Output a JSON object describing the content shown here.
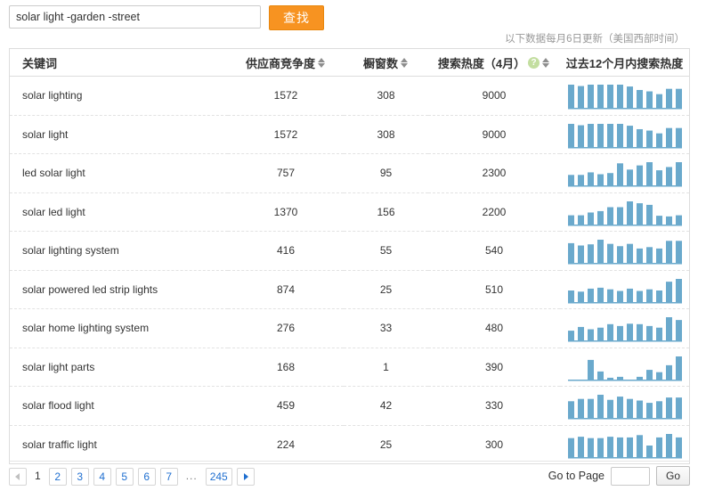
{
  "search": {
    "value": "solar light -garden -street",
    "placeholder": "",
    "button_label": "查找"
  },
  "update_note": "以下数据每月6日更新（美国西部时间）",
  "table": {
    "columns": {
      "keyword": "关键词",
      "competition": "供应商竞争度",
      "showcase": "橱窗数",
      "search_heat": "搜索热度（4月）",
      "trend": "过去12个月内搜索热度",
      "help_glyph": "?"
    },
    "rows": [
      {
        "keyword": "solar lighting",
        "competition": "1572",
        "showcase": "308",
        "search_heat": "9000",
        "trend": [
          100,
          94,
          100,
          100,
          100,
          100,
          92,
          77,
          71,
          59,
          82,
          82
        ]
      },
      {
        "keyword": "solar light",
        "competition": "1572",
        "showcase": "308",
        "search_heat": "9000",
        "trend": [
          100,
          94,
          100,
          100,
          100,
          100,
          92,
          77,
          71,
          59,
          82,
          82
        ]
      },
      {
        "keyword": "led solar light",
        "competition": "757",
        "showcase": "95",
        "search_heat": "2300",
        "trend": [
          45,
          45,
          56,
          48,
          53,
          95,
          68,
          86,
          100,
          65,
          79,
          100
        ]
      },
      {
        "keyword": "solar led light",
        "competition": "1370",
        "showcase": "156",
        "search_heat": "2200",
        "trend": [
          40,
          40,
          52,
          58,
          75,
          75,
          100,
          92,
          85,
          38,
          35,
          40
        ]
      },
      {
        "keyword": "solar lighting system",
        "competition": "416",
        "showcase": "55",
        "search_heat": "540",
        "trend": [
          85,
          75,
          80,
          100,
          82,
          72,
          82,
          62,
          68,
          62,
          95,
          95
        ]
      },
      {
        "keyword": "solar powered led strip lights",
        "competition": "874",
        "showcase": "25",
        "search_heat": "510",
        "trend": [
          50,
          45,
          58,
          62,
          55,
          48,
          58,
          48,
          55,
          50,
          88,
          100
        ]
      },
      {
        "keyword": "solar home lighting system",
        "competition": "276",
        "showcase": "33",
        "search_heat": "480",
        "trend": [
          42,
          58,
          48,
          55,
          70,
          62,
          72,
          70,
          62,
          55,
          100,
          88
        ]
      },
      {
        "keyword": "solar light parts",
        "competition": "168",
        "showcase": "1",
        "search_heat": "390",
        "trend": [
          0,
          0,
          85,
          35,
          8,
          12,
          0,
          12,
          42,
          32,
          62,
          100
        ]
      },
      {
        "keyword": "solar flood light",
        "competition": "459",
        "showcase": "42",
        "search_heat": "330",
        "trend": [
          72,
          82,
          82,
          100,
          78,
          92,
          82,
          75,
          65,
          72,
          88,
          88
        ]
      },
      {
        "keyword": "solar traffic light",
        "competition": "224",
        "showcase": "25",
        "search_heat": "300",
        "trend": [
          82,
          88,
          82,
          82,
          88,
          85,
          85,
          95,
          50,
          85,
          100,
          85
        ]
      }
    ]
  },
  "pagination": {
    "prev_label": "",
    "next_label": "",
    "current": "1",
    "pages": [
      "2",
      "3",
      "4",
      "5",
      "6",
      "7"
    ],
    "ellipsis": "...",
    "last": "245"
  },
  "goto": {
    "label": "Go to Page",
    "value": "",
    "placeholder": "",
    "button_label": "Go"
  },
  "colors": {
    "accent_orange": "#f79321",
    "bar_blue": "#6aa9cc",
    "link_blue": "#1f6fd0",
    "help_green": "#c3dea0"
  }
}
